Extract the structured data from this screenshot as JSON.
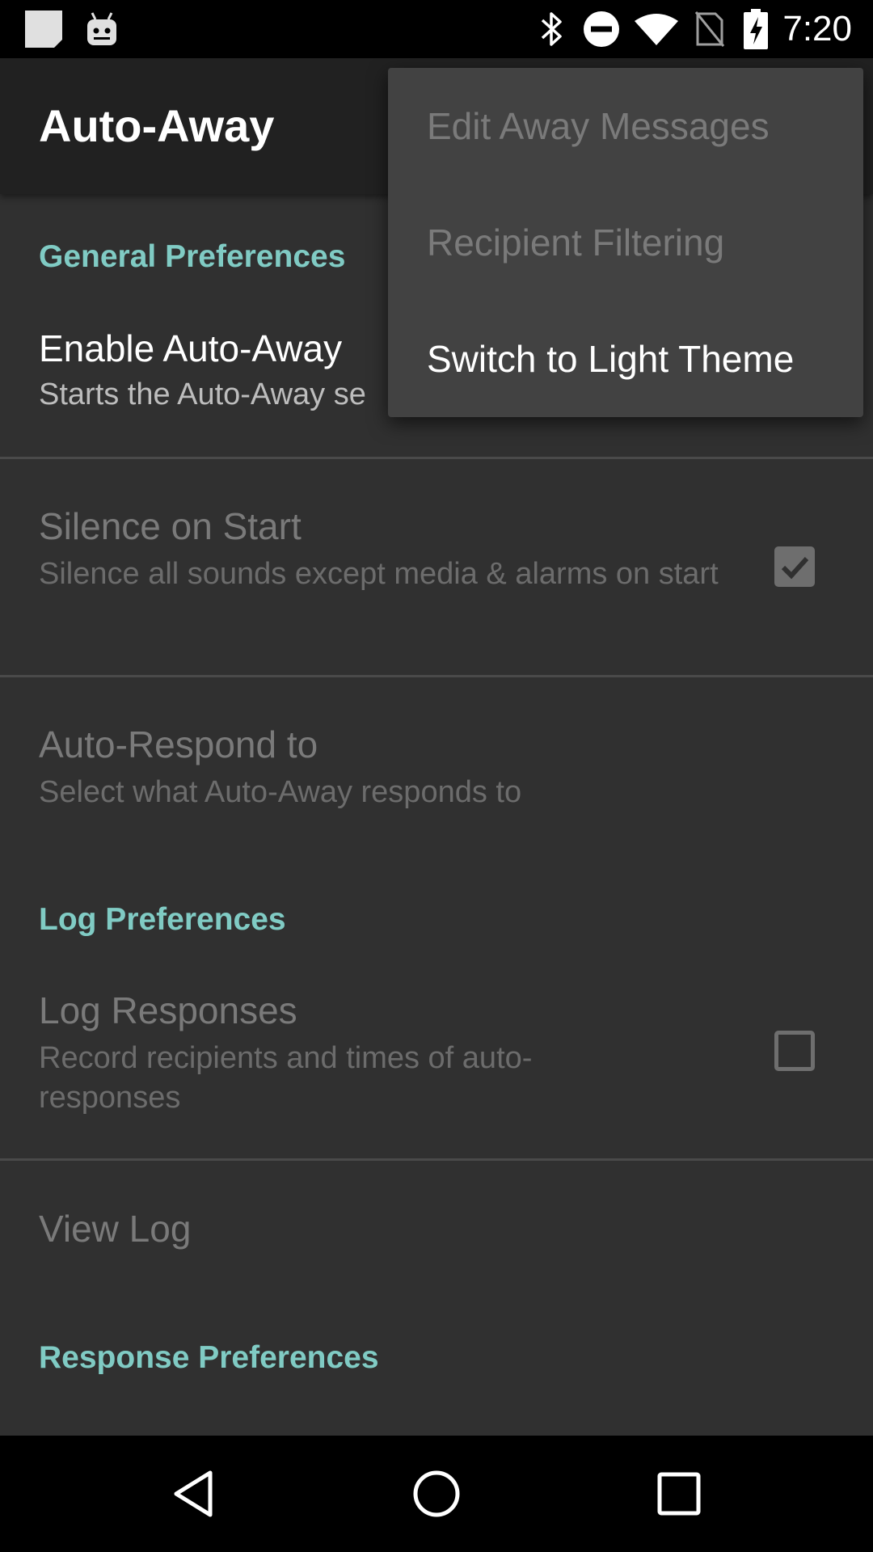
{
  "status_bar": {
    "time": "7:20",
    "left_icons": [
      "notification-icon",
      "android-icon"
    ],
    "right_icons": [
      "bluetooth-icon",
      "do-not-disturb-icon",
      "wifi-icon",
      "no-sim-icon",
      "battery-charging-icon"
    ]
  },
  "app_bar": {
    "title": "Auto-Away"
  },
  "sections": {
    "general": {
      "header": "General Preferences",
      "enable": {
        "title": "Enable Auto-Away",
        "summary": "Starts the Auto-Away se"
      },
      "silence": {
        "title": "Silence on Start",
        "summary": "Silence all sounds except media & alarms on start",
        "checked": true
      },
      "respond": {
        "title": "Auto-Respond to",
        "summary": "Select what Auto-Away responds to"
      }
    },
    "log": {
      "header": "Log Preferences",
      "log_responses": {
        "title": "Log Responses",
        "summary": "Record recipients and times of auto-responses",
        "checked": false
      },
      "view_log": {
        "title": "View Log"
      }
    },
    "response": {
      "header": "Response Preferences"
    }
  },
  "overflow_menu": {
    "items": [
      {
        "label": "Edit Away Messages",
        "enabled": false
      },
      {
        "label": "Recipient Filtering",
        "enabled": false
      },
      {
        "label": "Switch to Light Theme",
        "enabled": true
      }
    ]
  },
  "nav_bar": {
    "buttons": [
      "back-icon",
      "home-icon",
      "recents-icon"
    ]
  },
  "colors": {
    "accent": "#80cbc4",
    "background": "#303030",
    "app_bar": "#212121",
    "menu": "#424242"
  }
}
